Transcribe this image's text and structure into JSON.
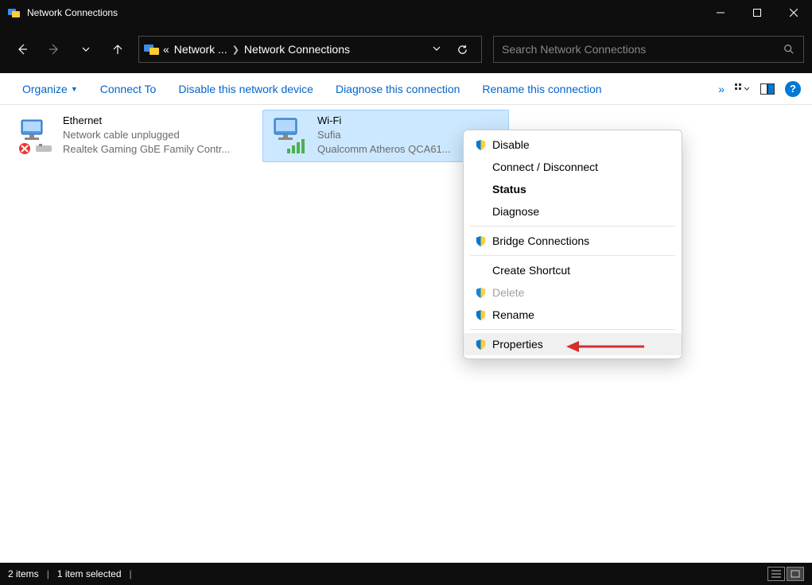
{
  "window": {
    "title": "Network Connections"
  },
  "breadcrumb": {
    "separator": "«",
    "part1": "Network ...",
    "part2": "Network Connections"
  },
  "search": {
    "placeholder": "Search Network Connections"
  },
  "toolbar": {
    "organize": "Organize",
    "connect_to": "Connect To",
    "disable": "Disable this network device",
    "diagnose": "Diagnose this connection",
    "rename": "Rename this connection",
    "overflow": "»"
  },
  "adapters": [
    {
      "name": "Ethernet",
      "status": "Network cable unplugged",
      "device": "Realtek Gaming GbE Family Contr..."
    },
    {
      "name": "Wi-Fi",
      "status": "Sufia",
      "device": "Qualcomm Atheros QCA61..."
    }
  ],
  "context_menu": {
    "disable": "Disable",
    "connect_disconnect": "Connect / Disconnect",
    "status": "Status",
    "diagnose": "Diagnose",
    "bridge": "Bridge Connections",
    "create_shortcut": "Create Shortcut",
    "delete": "Delete",
    "rename": "Rename",
    "properties": "Properties"
  },
  "statusbar": {
    "items": "2 items",
    "selected": "1 item selected"
  }
}
